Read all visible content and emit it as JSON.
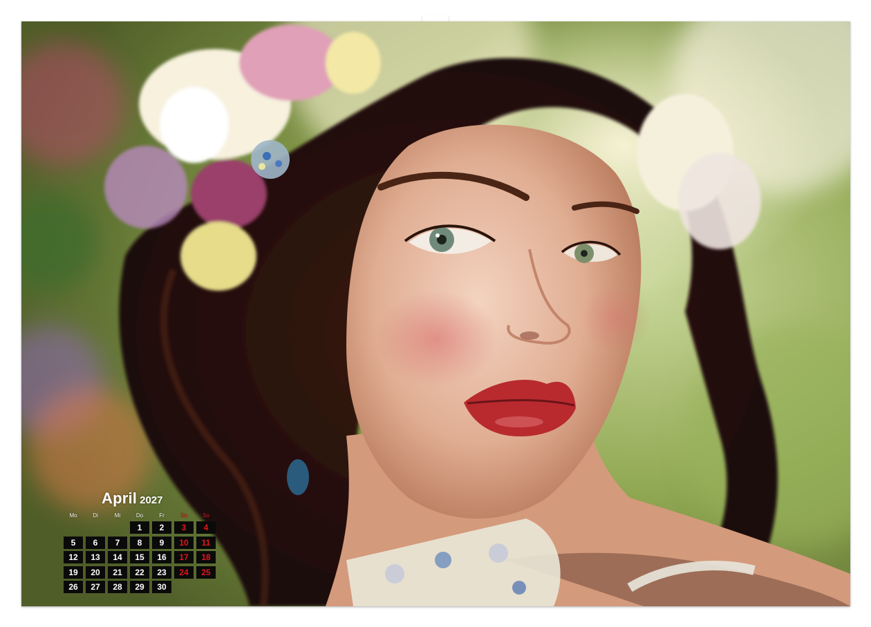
{
  "calendar": {
    "month": "April",
    "year": "2027",
    "weekdays": [
      {
        "label": "Mo",
        "weekend": false
      },
      {
        "label": "Di",
        "weekend": false
      },
      {
        "label": "Mi",
        "weekend": false
      },
      {
        "label": "Do",
        "weekend": false
      },
      {
        "label": "Fr",
        "weekend": false
      },
      {
        "label": "Sa",
        "weekend": true
      },
      {
        "label": "So",
        "weekend": true
      }
    ],
    "first_weekday_index": 3,
    "days_in_month": 30,
    "weekend_color": "#e3161a",
    "cell_color": "#0a0a0a"
  },
  "photo": {
    "subject": "portrait-photo"
  }
}
